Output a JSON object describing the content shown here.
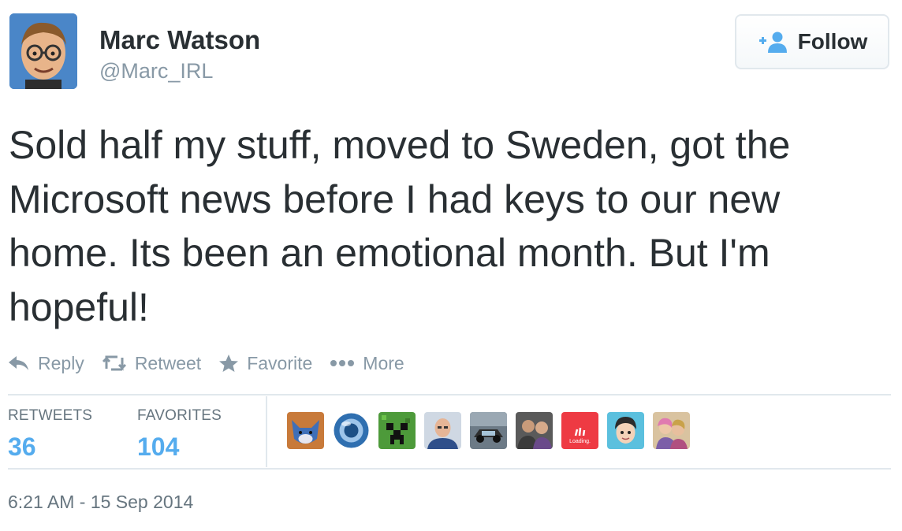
{
  "user": {
    "name": "Marc Watson",
    "handle": "@Marc_IRL",
    "avatar_icon": "cartoon-avatar-icon"
  },
  "follow_button": {
    "label": "Follow",
    "icon": "add-user-icon"
  },
  "tweet": {
    "text": "Sold half my stuff, moved to Sweden, got the Microsoft news before I had keys to our new home. Its been an emotional month. But I'm hopeful!"
  },
  "actions": [
    {
      "label": "Reply",
      "icon": "reply-icon"
    },
    {
      "label": "Retweet",
      "icon": "retweet-icon"
    },
    {
      "label": "Favorite",
      "icon": "star-icon"
    },
    {
      "label": "More",
      "icon": "more-dots-icon"
    }
  ],
  "stats": {
    "retweets_label": "RETWEETS",
    "retweets_value": "36",
    "favorites_label": "FAVORITES",
    "favorites_value": "104"
  },
  "favoriters": [
    {
      "icon": "wolf-avatar-icon"
    },
    {
      "icon": "chrome-orb-avatar-icon"
    },
    {
      "icon": "creeper-avatar-icon"
    },
    {
      "icon": "man-avatar-icon"
    },
    {
      "icon": "car-photo-avatar-icon"
    },
    {
      "icon": "group-photo-avatar-icon"
    },
    {
      "icon": "loading-avatar-icon",
      "text": "Loading."
    },
    {
      "icon": "cartoon-boy-avatar-icon"
    },
    {
      "icon": "couple-photo-avatar-icon"
    }
  ],
  "timestamp": "6:21 AM - 15 Sep 2014",
  "colors": {
    "text": "#292f33",
    "muted": "#8899a6",
    "accent": "#55acee",
    "divider": "#e1e8ed"
  }
}
